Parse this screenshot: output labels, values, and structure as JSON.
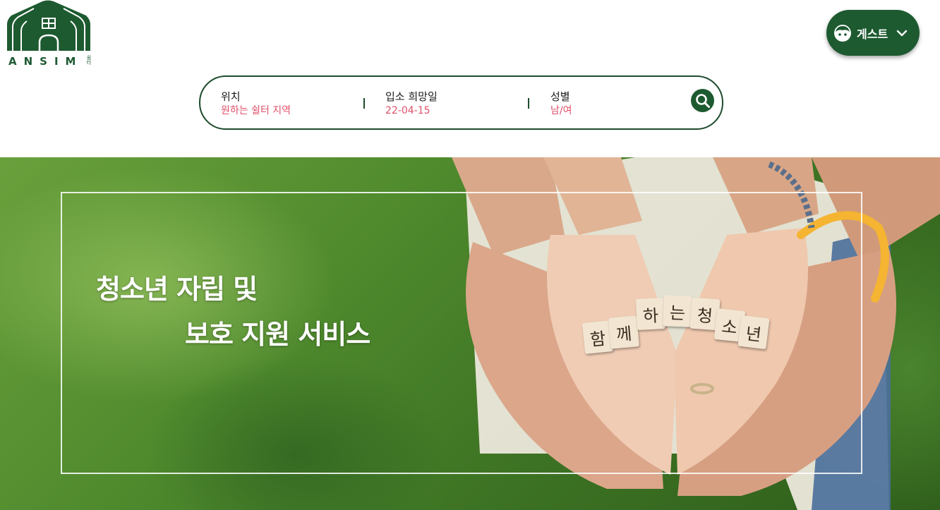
{
  "brand": {
    "name": "ANSIM",
    "sub": "쉼터"
  },
  "user_menu": {
    "label": "게스트"
  },
  "search": {
    "location": {
      "title": "위치",
      "value": "원하는 쉴터 지역"
    },
    "date": {
      "title": "입소 희망일",
      "value": "22-04-15"
    },
    "gender": {
      "title": "성별",
      "value": "남/여"
    }
  },
  "hero": {
    "title_line1": "청소년 자립 및",
    "title_line2": "보호 지원 서비스",
    "tiles": [
      "함",
      "께",
      "하",
      "는",
      "청",
      "소",
      "년"
    ]
  },
  "colors": {
    "brand_green": "#1d5a30",
    "accent_pink": "#e0506a"
  }
}
